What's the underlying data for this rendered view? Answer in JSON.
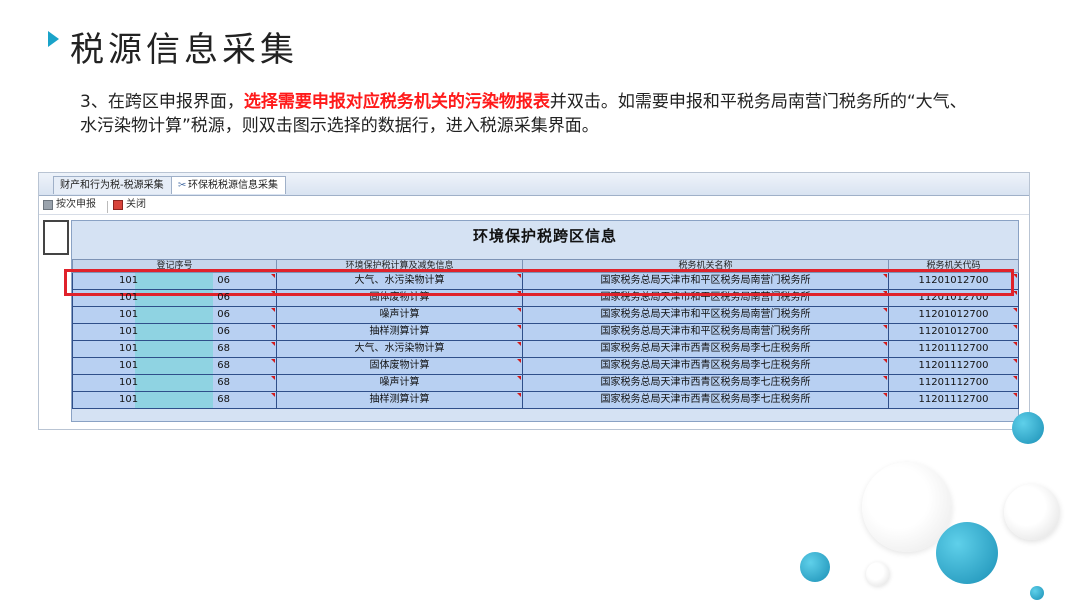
{
  "slide": {
    "title": "税源信息采集",
    "desc_prefix": "3、在跨区申报界面，",
    "desc_highlight": "选择需要申报对应税务机关的污染物报表",
    "desc_suffix": "并双击。如需要申报和平税务局南营门税务所的“大气、水污染物计算”税源，则双击图示选择的数据行，进入税源采集界面。"
  },
  "window": {
    "tabs": [
      {
        "label": "财产和行为税-税源采集"
      },
      {
        "label": "环保税税源信息采集"
      }
    ],
    "toolbar": {
      "submit_label": "按次申报",
      "close_label": "关闭"
    },
    "panel_title": "环境保护税跨区信息",
    "columns": [
      "登记序号",
      "环境保护税计算及减免信息",
      "税务机关名称",
      "税务机关代码"
    ],
    "rows": [
      {
        "reg_a": "101",
        "reg_b": "06",
        "calc": "大气、水污染物计算",
        "org": "国家税务总局天津市和平区税务局南营门税务所",
        "code": "11201012700"
      },
      {
        "reg_a": "101",
        "reg_b": "06",
        "calc": "固体废物计算",
        "org": "国家税务总局天津市和平区税务局南营门税务所",
        "code": "11201012700"
      },
      {
        "reg_a": "101",
        "reg_b": "06",
        "calc": "噪声计算",
        "org": "国家税务总局天津市和平区税务局南营门税务所",
        "code": "11201012700"
      },
      {
        "reg_a": "101",
        "reg_b": "06",
        "calc": "抽样测算计算",
        "org": "国家税务总局天津市和平区税务局南营门税务所",
        "code": "11201012700"
      },
      {
        "reg_a": "101",
        "reg_b": "68",
        "calc": "大气、水污染物计算",
        "org": "国家税务总局天津市西青区税务局李七庄税务所",
        "code": "11201112700"
      },
      {
        "reg_a": "101",
        "reg_b": "68",
        "calc": "固体废物计算",
        "org": "国家税务总局天津市西青区税务局李七庄税务所",
        "code": "11201112700"
      },
      {
        "reg_a": "101",
        "reg_b": "68",
        "calc": "噪声计算",
        "org": "国家税务总局天津市西青区税务局李七庄税务所",
        "code": "11201112700"
      },
      {
        "reg_a": "101",
        "reg_b": "68",
        "calc": "抽样测算计算",
        "org": "国家税务总局天津市西青区税务局李七庄税务所",
        "code": "11201112700"
      }
    ]
  },
  "colors": {
    "accent": "#1aa3c9",
    "highlight": "#ff1a1a",
    "selection": "#e0222b",
    "row_bg": "#b8d0f2"
  }
}
